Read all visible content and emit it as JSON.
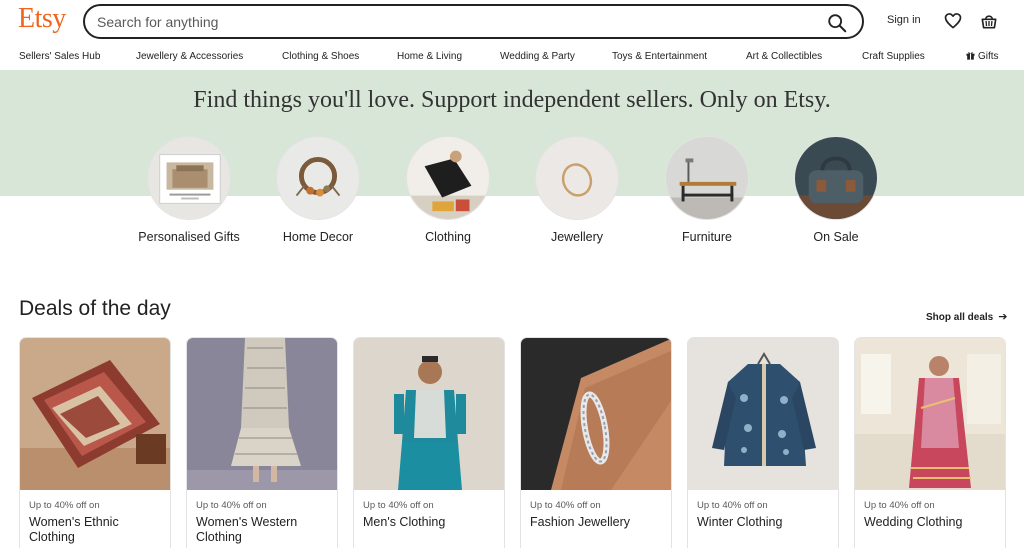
{
  "header": {
    "logo": "Etsy",
    "search_placeholder": "Search for anything",
    "signin_label": "Sign in"
  },
  "nav": {
    "items": [
      "Sellers' Sales Hub",
      "Jewellery & Accessories",
      "Clothing & Shoes",
      "Home & Living",
      "Wedding & Party",
      "Toys & Entertainment",
      "Art & Collectibles",
      "Craft Supplies",
      "Gifts"
    ]
  },
  "hero": {
    "title": "Find things you'll love. Support independent sellers. Only on Etsy.",
    "categories": [
      "Personalised Gifts",
      "Home Decor",
      "Clothing",
      "Jewellery",
      "Furniture",
      "On Sale"
    ]
  },
  "deals": {
    "title": "Deals of the day",
    "shop_all_label": "Shop all deals",
    "cards": [
      {
        "subtitle": "Up to 40% off on",
        "title": "Women's Ethnic Clothing"
      },
      {
        "subtitle": "Up to 40% off on",
        "title": "Women's Western Clothing"
      },
      {
        "subtitle": "Up to 40% off on",
        "title": "Men's Clothing"
      },
      {
        "subtitle": "Up to 40% off on",
        "title": "Fashion Jewellery"
      },
      {
        "subtitle": "Up to 40% off on",
        "title": "Winter Clothing"
      },
      {
        "subtitle": "Up to 40% off on",
        "title": "Wedding Clothing"
      }
    ]
  },
  "colors": {
    "brand": "#f1641e",
    "hero_background": "#d7e6d6",
    "text": "#222222"
  },
  "icons": [
    "search-icon",
    "heart-icon",
    "basket-icon",
    "gift-icon",
    "arrow-right-icon"
  ]
}
